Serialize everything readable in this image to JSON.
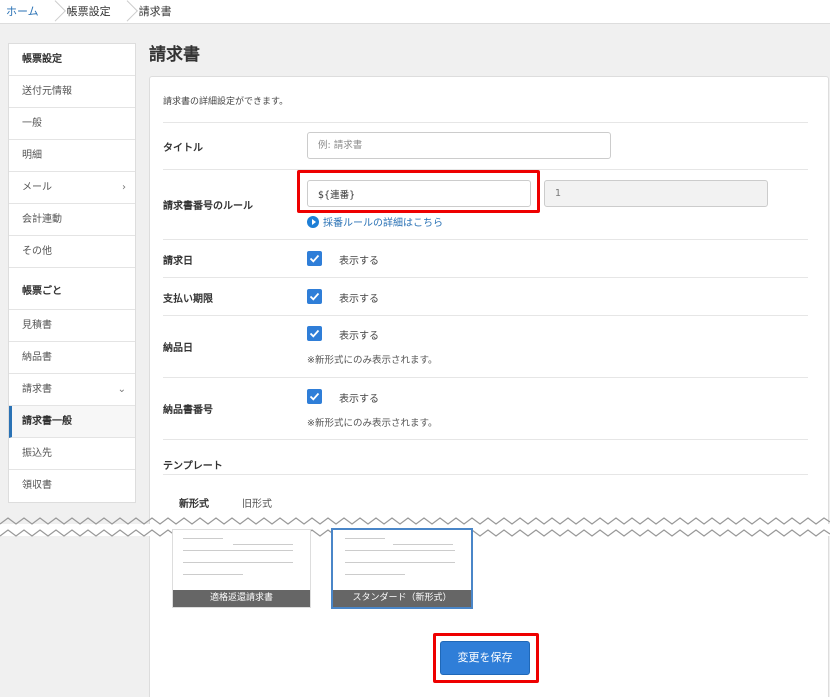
{
  "breadcrumb": [
    "ホーム",
    "帳票設定",
    "請求書"
  ],
  "sidebar": {
    "section1": "帳票設定",
    "items1": [
      "送付元情報",
      "一般",
      "明細",
      "メール",
      "会計連動",
      "その他"
    ],
    "section2": "帳票ごと",
    "items2": [
      "見積書",
      "納品書",
      "請求書",
      "請求書一般",
      "振込先",
      "領収書"
    ]
  },
  "page_title": "請求書",
  "description": "請求書の詳細設定ができます。",
  "form": {
    "title_label": "タイトル",
    "title_placeholder": "例: 請求書",
    "number_rule_label": "請求書番号のルール",
    "number_rule_value": "${連番}",
    "number_start_value": "1",
    "number_rule_link": "採番ルールの詳細はこちら",
    "invoice_date_label": "請求日",
    "invoice_date_check": "表示する",
    "due_date_label": "支払い期限",
    "due_date_check": "表示する",
    "delivery_date_label": "納品日",
    "delivery_date_check": "表示する",
    "delivery_date_note": "※新形式にのみ表示されます。",
    "delivery_no_label": "納品書番号",
    "delivery_no_check": "表示する",
    "delivery_no_note": "※新形式にのみ表示されます。"
  },
  "template": {
    "label": "テンプレート",
    "tabs": [
      "新形式",
      "旧形式"
    ],
    "thumbnails": [
      "適格返還請求書",
      "スタンダード（新形式）"
    ]
  },
  "save_button": "変更を保存",
  "colors": {
    "accent": "#2f7ed8",
    "highlight": "#ee0000",
    "link": "#2a72b5"
  }
}
